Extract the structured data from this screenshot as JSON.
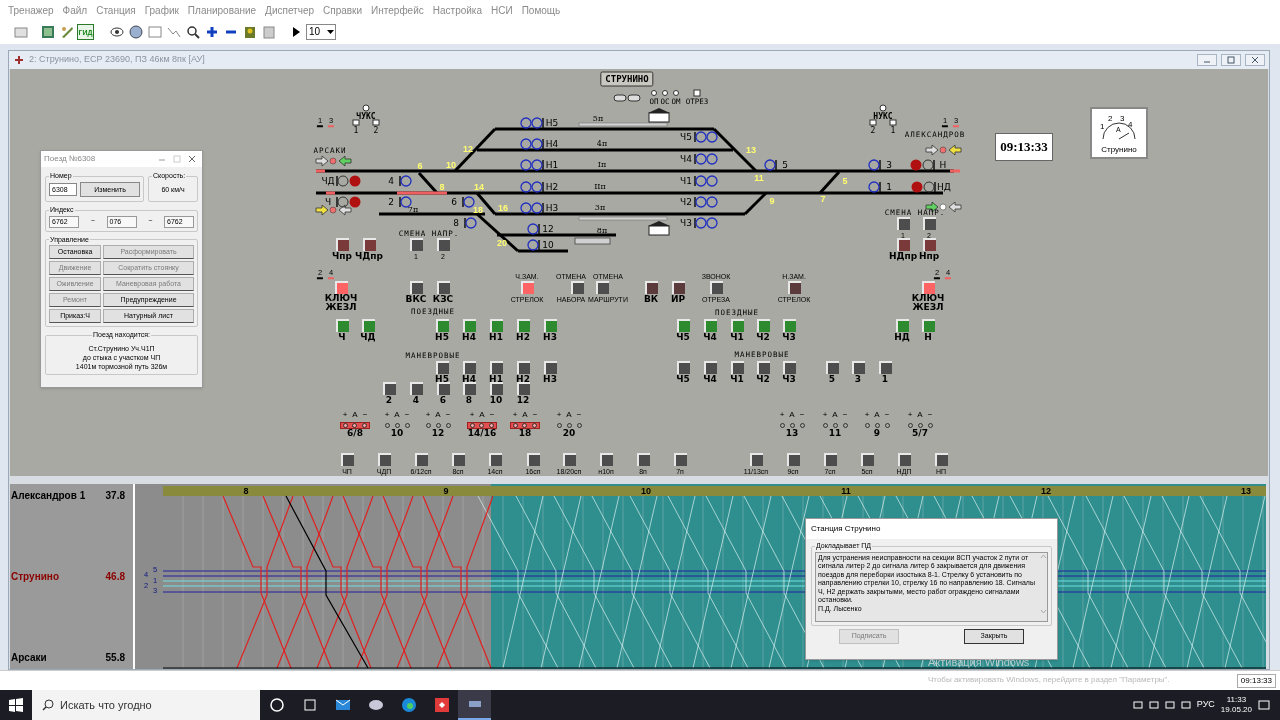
{
  "menu": [
    "Тренажер",
    "Файл",
    "Станция",
    "График",
    "Планирование",
    "Диспетчер",
    "Справки",
    "Интерфейс",
    "Настройка",
    "НСИ",
    "Помощь"
  ],
  "toolbar": {
    "gid_label": "ГИД",
    "speed": "10"
  },
  "window": {
    "title": "2: Струнино, ЕСР 23690, ПЗ 46км 8пк [АУ]"
  },
  "station": {
    "name": "СТРУНИНО",
    "top_labels": [
      "ОП",
      "ОС",
      "ОМ",
      "ОТРЕЗ"
    ],
    "neck_labels": [
      "ЧУКС",
      "1",
      "2",
      "НУКС",
      "2",
      "1",
      "АРСАКИ",
      "АЛЕКСАНДРОВ"
    ],
    "marker_labels": [
      "1",
      "3",
      "1",
      "3",
      "2",
      "4",
      "2",
      "4"
    ],
    "track_labels": [
      "5п",
      "4п",
      "Iп",
      "IIп",
      "7п",
      "3п",
      "8п"
    ],
    "switch_numbers": [
      "6",
      "10",
      "12",
      "8",
      "14",
      "18",
      "16",
      "20",
      "13",
      "11",
      "9",
      "7",
      "5"
    ],
    "signals": [
      {
        "label": "Н5",
        "kind": "double"
      },
      {
        "label": "Н4",
        "kind": "double"
      },
      {
        "label": "Н1",
        "kind": "double"
      },
      {
        "label": "Н2",
        "kind": "double"
      },
      {
        "label": "Н3",
        "kind": "double"
      },
      {
        "label": "12",
        "kind": "single"
      },
      {
        "label": "10",
        "kind": "single"
      },
      {
        "label": "Ч5",
        "kind": "double"
      },
      {
        "label": "Ч4",
        "kind": "double"
      },
      {
        "label": "Ч1",
        "kind": "double"
      },
      {
        "label": "Ч2",
        "kind": "double"
      },
      {
        "label": "Ч3",
        "kind": "double"
      },
      {
        "label": "4",
        "kind": "single"
      },
      {
        "label": "2",
        "kind": "single"
      },
      {
        "label": "6",
        "kind": "single"
      },
      {
        "label": "8",
        "kind": "single"
      },
      {
        "label": "5",
        "kind": "single"
      },
      {
        "label": "3",
        "kind": "single"
      },
      {
        "label": "1",
        "kind": "single"
      },
      {
        "label": "ЧД",
        "kind": "entry"
      },
      {
        "label": "Ч",
        "kind": "entry"
      },
      {
        "label": "Н",
        "kind": "entry"
      },
      {
        "label": "НД",
        "kind": "entry"
      }
    ],
    "headings": [
      "СМЕНА НАПР.",
      "СМЕНА НАПР.",
      "ПОЕЗДНЫЕ",
      "ПОЕЗДНЫЕ",
      "МАНЕВРОВЫЕ",
      "МАНЕВРОВЫЕ"
    ],
    "buttons": [
      {
        "label": "Чпр",
        "color": "#7a3a3a"
      },
      {
        "label": "ЧДпр",
        "color": "#7a3a3a"
      },
      {
        "label": "1",
        "color": "#4d4d4d"
      },
      {
        "label": "2",
        "color": "#4d4d4d"
      },
      {
        "label": "1",
        "color": "#4d4d4d"
      },
      {
        "label": "2",
        "color": "#4d4d4d"
      },
      {
        "label": "НДпр",
        "color": "#7a3a3a"
      },
      {
        "label": "Нпр",
        "color": "#7a3a3a"
      },
      {
        "label": "КЛЮЧ ЖЕЗЛ",
        "color": "#ff6464"
      },
      {
        "label": "ВКС",
        "color": "#4d4d4d"
      },
      {
        "label": "КЗС",
        "color": "#4d4d4d"
      },
      {
        "caption": "Ч.ЗАМ.",
        "label": "СТРЕЛОК",
        "color": "#ff6464"
      },
      {
        "caption": "ОТМЕНА",
        "label": "НАБОРА",
        "color": "#4d4d4d"
      },
      {
        "caption": "ОТМЕНА",
        "label": "МАРШРУТИ",
        "color": "#4d4d4d"
      },
      {
        "label": "ВК",
        "color": "#5a3a3a"
      },
      {
        "label": "ИР",
        "color": "#5a3a3a"
      },
      {
        "caption": "ЗВОНОК",
        "label": "ОТРЕЗА",
        "color": "#4d4d4d"
      },
      {
        "caption": "Н.ЗАМ.",
        "label": "СТРЕЛОК",
        "color": "#5a3a3a"
      },
      {
        "label": "КЛЮЧ ЖЕЗЛ",
        "color": "#ff6464"
      },
      {
        "label": "Ч",
        "color": "#2e8a2e"
      },
      {
        "label": "ЧД",
        "color": "#2e8a2e"
      },
      {
        "label": "Н5",
        "color": "#2e8a2e"
      },
      {
        "label": "Н4",
        "color": "#2e8a2e"
      },
      {
        "label": "Н1",
        "color": "#2e8a2e"
      },
      {
        "label": "Н2",
        "color": "#2e8a2e"
      },
      {
        "label": "Н3",
        "color": "#2e8a2e"
      },
      {
        "label": "Ч5",
        "color": "#2e8a2e"
      },
      {
        "label": "Ч4",
        "color": "#2e8a2e"
      },
      {
        "label": "Ч1",
        "color": "#2e8a2e"
      },
      {
        "label": "Ч2",
        "color": "#2e8a2e"
      },
      {
        "label": "Ч3",
        "color": "#2e8a2e"
      },
      {
        "label": "НД",
        "color": "#2e8a2e"
      },
      {
        "label": "Н",
        "color": "#2e8a2e"
      },
      {
        "label": "Н5",
        "color": "#4d4d4d"
      },
      {
        "label": "Н4",
        "color": "#4d4d4d"
      },
      {
        "label": "Н1",
        "color": "#4d4d4d"
      },
      {
        "label": "Н2",
        "color": "#4d4d4d"
      },
      {
        "label": "Н3",
        "color": "#4d4d4d"
      },
      {
        "label": "Ч5",
        "color": "#4d4d4d"
      },
      {
        "label": "Ч4",
        "color": "#4d4d4d"
      },
      {
        "label": "Ч1",
        "color": "#4d4d4d"
      },
      {
        "label": "Ч2",
        "color": "#4d4d4d"
      },
      {
        "label": "Ч3",
        "color": "#4d4d4d"
      },
      {
        "label": "5",
        "color": "#4d4d4d"
      },
      {
        "label": "3",
        "color": "#4d4d4d"
      },
      {
        "label": "1",
        "color": "#4d4d4d"
      },
      {
        "label": "2",
        "color": "#4d4d4d"
      },
      {
        "label": "4",
        "color": "#4d4d4d"
      },
      {
        "label": "6",
        "color": "#4d4d4d"
      },
      {
        "label": "8",
        "color": "#4d4d4d"
      },
      {
        "label": "10",
        "color": "#4d4d4d"
      },
      {
        "label": "12",
        "color": "#4d4d4d"
      },
      {
        "label": "ЧП",
        "color": "#4d4d4d"
      },
      {
        "label": "ЧДП",
        "color": "#4d4d4d"
      },
      {
        "label": "6/12сп",
        "color": "#4d4d4d"
      },
      {
        "label": "8сп",
        "color": "#4d4d4d"
      },
      {
        "label": "14сп",
        "color": "#4d4d4d"
      },
      {
        "label": "16сп",
        "color": "#4d4d4d"
      },
      {
        "label": "18/20сп",
        "color": "#4d4d4d"
      },
      {
        "label": "н10п",
        "color": "#4d4d4d"
      },
      {
        "label": "8п",
        "color": "#4d4d4d"
      },
      {
        "label": "7п",
        "color": "#4d4d4d"
      },
      {
        "label": "11/13сп",
        "color": "#4d4d4d"
      },
      {
        "label": "9сп",
        "color": "#4d4d4d"
      },
      {
        "label": "7сп",
        "color": "#4d4d4d"
      },
      {
        "label": "5сп",
        "color": "#4d4d4d"
      },
      {
        "label": "НДП",
        "color": "#4d4d4d"
      },
      {
        "label": "НП",
        "color": "#4d4d4d"
      }
    ],
    "switch_controls": [
      {
        "label": "6/8",
        "marks": [
          "+",
          "А",
          "−"
        ],
        "locked": true
      },
      {
        "label": "10",
        "marks": [
          "+",
          "А",
          "−"
        ],
        "locked": false
      },
      {
        "label": "12",
        "marks": [
          "+",
          "А",
          "−"
        ],
        "locked": false
      },
      {
        "label": "14/16",
        "marks": [
          "+",
          "А",
          "−"
        ],
        "locked": true
      },
      {
        "label": "18",
        "marks": [
          "+",
          "А",
          "−"
        ],
        "locked": true
      },
      {
        "label": "20",
        "marks": [
          "+",
          "А",
          "−"
        ],
        "locked": false
      },
      {
        "label": "13",
        "marks": [
          "+",
          "А",
          "−"
        ],
        "locked": false
      },
      {
        "label": "11",
        "marks": [
          "+",
          "А",
          "−"
        ],
        "locked": false
      },
      {
        "label": "9",
        "marks": [
          "+",
          "А",
          "−"
        ],
        "locked": false
      },
      {
        "label": "5/7",
        "marks": [
          "+",
          "А",
          "−"
        ],
        "locked": false
      }
    ]
  },
  "clock": "09:13:33",
  "gauge": {
    "marks": [
      "1",
      "2",
      "3",
      "4"
    ],
    "letter": "А",
    "label": "Струнино"
  },
  "train_dialog": {
    "title": "Поезд №6308",
    "number_legend": "Номер",
    "number": "6308",
    "change_button": "Изменить",
    "speed_legend": "Скорость:",
    "speed": "60 км/ч",
    "index_legend": "Индекс",
    "index": [
      "6762",
      "076",
      "6762"
    ],
    "index_separators": [
      "−",
      "−"
    ],
    "control_legend": "Управление",
    "buttons": [
      {
        "label": "Остановка",
        "disabled": false
      },
      {
        "label": "Расформировать",
        "disabled": true
      },
      {
        "label": "Движение",
        "disabled": true
      },
      {
        "label": "Сократить стоянку",
        "disabled": true
      },
      {
        "label": "Оживление",
        "disabled": true
      },
      {
        "label": "Маневровая работа",
        "disabled": true
      },
      {
        "label": "Ремонт",
        "disabled": true
      },
      {
        "label": "Предупреждение",
        "disabled": false
      },
      {
        "label": "Приказ:Ч",
        "disabled": false
      },
      {
        "label": "Натурный лист",
        "disabled": false
      }
    ],
    "location_legend": "Поезд находится:",
    "location": [
      "Ст.Струнино Уч.Ч1П",
      "до стыка с участком ЧП",
      "1401м тормозной путь 326м"
    ]
  },
  "graph": {
    "hours": [
      "8",
      "9",
      "10",
      "11",
      "12",
      "13"
    ],
    "track_numbers": [
      "5",
      "4",
      "1",
      "2",
      "3"
    ],
    "stations": [
      {
        "name": "Александров 1",
        "km": "37.8",
        "highlighted": false
      },
      {
        "name": "Струнино",
        "km": "46.8",
        "highlighted": true
      },
      {
        "name": "Арсаки",
        "km": "55.8",
        "highlighted": false
      }
    ]
  },
  "station_dialog": {
    "title": "Станция Струнино",
    "legend": "Докладывает ПД",
    "report": "Для устранения неисправности на секции 8СП участок 2 пути от сигнала литер 2 до сигнала литер 6 закрывается для движения поездов для переборки изостыка 8-1. Стрелку 6 установить по направлению стрелки 10, стрелку 16 по направлению 18. Сигналы Ч, Н2 держать закрытыми, место работ ограждено сигналами остановки.",
    "signature": "П.Д. Лысенко",
    "buttons": [
      {
        "label": "Подписать",
        "disabled": true
      },
      {
        "label": "Закрыть",
        "disabled": false
      }
    ]
  },
  "os_notice": [
    "Активация Windows",
    "Чтобы активировать Windows, перейдите в раздел \"Параметры\"."
  ],
  "status_bar": {
    "time": "09:13:33"
  },
  "taskbar": {
    "search_placeholder": "Искать что угодно",
    "language": "РУС",
    "time": "11:33",
    "date": "19.05.20"
  }
}
